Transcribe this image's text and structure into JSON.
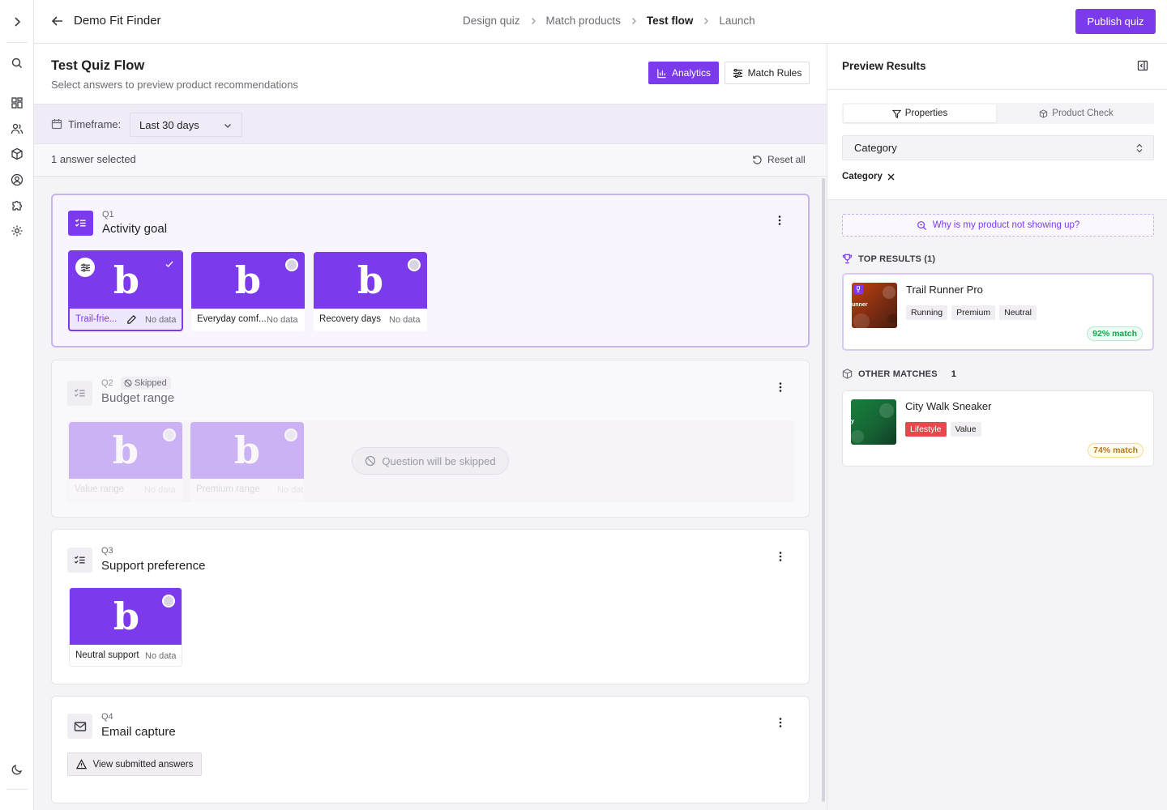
{
  "app": {
    "title": "Demo Fit Finder"
  },
  "breadcrumbs": [
    "Design quiz",
    "Match products",
    "Test flow",
    "Launch"
  ],
  "breadcrumb_active": "Test flow",
  "publish_label": "Publish quiz",
  "rail_icons": [
    "chevron-right-icon",
    "search-icon",
    "dashboard-icon",
    "users-icon",
    "box-icon",
    "user-circle-icon",
    "puzzle-icon",
    "settings-icon",
    "moon-icon"
  ],
  "main": {
    "title": "Test Quiz Flow",
    "subtitle": "Select answers to preview product recommendations",
    "analytics_label": "Analytics",
    "match_rules_label": "Match Rules",
    "timeframe_label": "Timeframe:",
    "timeframe_value": "Last 30 days",
    "selected_count": "1 answer selected",
    "reset_label": "Reset all"
  },
  "questions": [
    {
      "num": "Q1",
      "title": "Activity goal",
      "options": [
        {
          "label": "Trail-frie...",
          "data": "No data",
          "image_letter": "b",
          "selected": true
        },
        {
          "label": "Everyday comf...",
          "data": "No data",
          "image_letter": "b",
          "selected": false
        },
        {
          "label": "Recovery days",
          "data": "No data",
          "image_letter": "b",
          "selected": false
        }
      ]
    },
    {
      "num": "Q2",
      "badge": "Skipped",
      "title": "Budget range",
      "skipped_message": "Question will be skipped",
      "options": [
        {
          "label": "Value range",
          "data": "No data",
          "image_letter": "b"
        },
        {
          "label": "Premium range",
          "data": "No data",
          "image_letter": "b"
        }
      ]
    },
    {
      "num": "Q3",
      "title": "Support preference",
      "options": [
        {
          "label": "Neutral support",
          "data": "No data",
          "image_letter": "b",
          "selected": false
        }
      ]
    },
    {
      "num": "Q4",
      "title": "Email capture",
      "button_label": "View submitted answers"
    }
  ],
  "preview": {
    "title": "Preview Results",
    "tabs": [
      "Properties",
      "Product Check"
    ],
    "active_tab": "Properties",
    "select_value": "Category",
    "chip": "Category",
    "why_label": "Why is my product not showing up?",
    "top_results_label": "TOP RESULTS (1)",
    "other_matches_label": "OTHER MATCHES",
    "other_matches_count": "1",
    "top": [
      {
        "name": "Trail Runner Pro",
        "tags": [
          "Running",
          "Premium",
          "Neutral"
        ],
        "match": "92% match",
        "thumb_text": "unner"
      }
    ],
    "other": [
      {
        "name": "City Walk Sneaker",
        "tags": [
          "Lifestyle",
          "Value"
        ],
        "match": "74% match",
        "thumb_text": "y"
      }
    ]
  },
  "colors": {
    "accent": "#7c3aed",
    "match_green": "#16a34a",
    "match_amber": "#b7791f",
    "tag_red": "#e5484d"
  }
}
